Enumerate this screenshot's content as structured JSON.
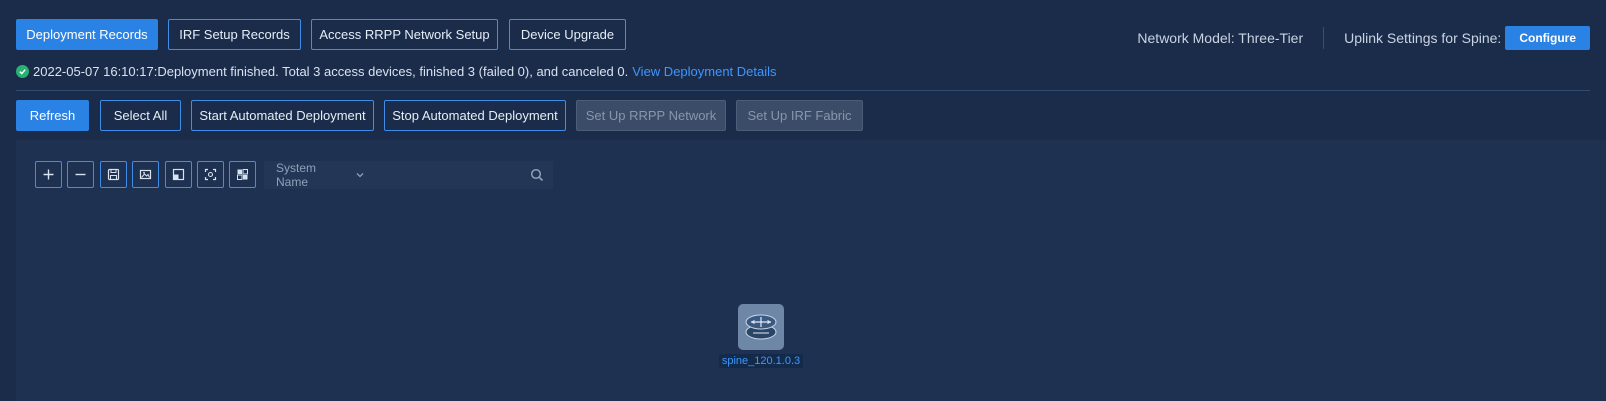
{
  "top_tabs": [
    {
      "label": "Deployment Records"
    },
    {
      "label": "IRF Setup Records"
    },
    {
      "label": "Access RRPP Network Setup"
    },
    {
      "label": "Device Upgrade"
    }
  ],
  "header": {
    "network_model": "Network Model: Three-Tier",
    "uplink_label": "Uplink Settings for Spine:",
    "configure_label": "Configure"
  },
  "status": {
    "message": "2022-05-07 16:10:17:Deployment finished. Total 3 access devices, finished 3 (failed 0), and canceled 0.",
    "link_label": "View Deployment Details",
    "icon": "check-circle-icon",
    "color": "#27b272"
  },
  "actions": [
    {
      "label": "Refresh"
    },
    {
      "label": "Select All"
    },
    {
      "label": "Start Automated Deployment"
    },
    {
      "label": "Stop Automated Deployment"
    },
    {
      "label": "Set Up RRPP Network"
    },
    {
      "label": "Set Up IRF Fabric"
    }
  ],
  "toolbar": {
    "icons": [
      "zoom-in-icon",
      "zoom-out-icon",
      "save-icon",
      "export-image-icon",
      "fit-window-icon",
      "focus-icon",
      "layout-icon"
    ]
  },
  "search": {
    "field_label": "System Name",
    "value": "",
    "placeholder": ""
  },
  "topology": {
    "nodes": [
      {
        "label": "spine_120.1.0.3",
        "icon": "spine-switch-icon"
      }
    ]
  },
  "colors": {
    "background": "#1a2c4a",
    "canvas": "#1f3150",
    "accent": "#2a82e4",
    "link": "#3f96ff"
  }
}
